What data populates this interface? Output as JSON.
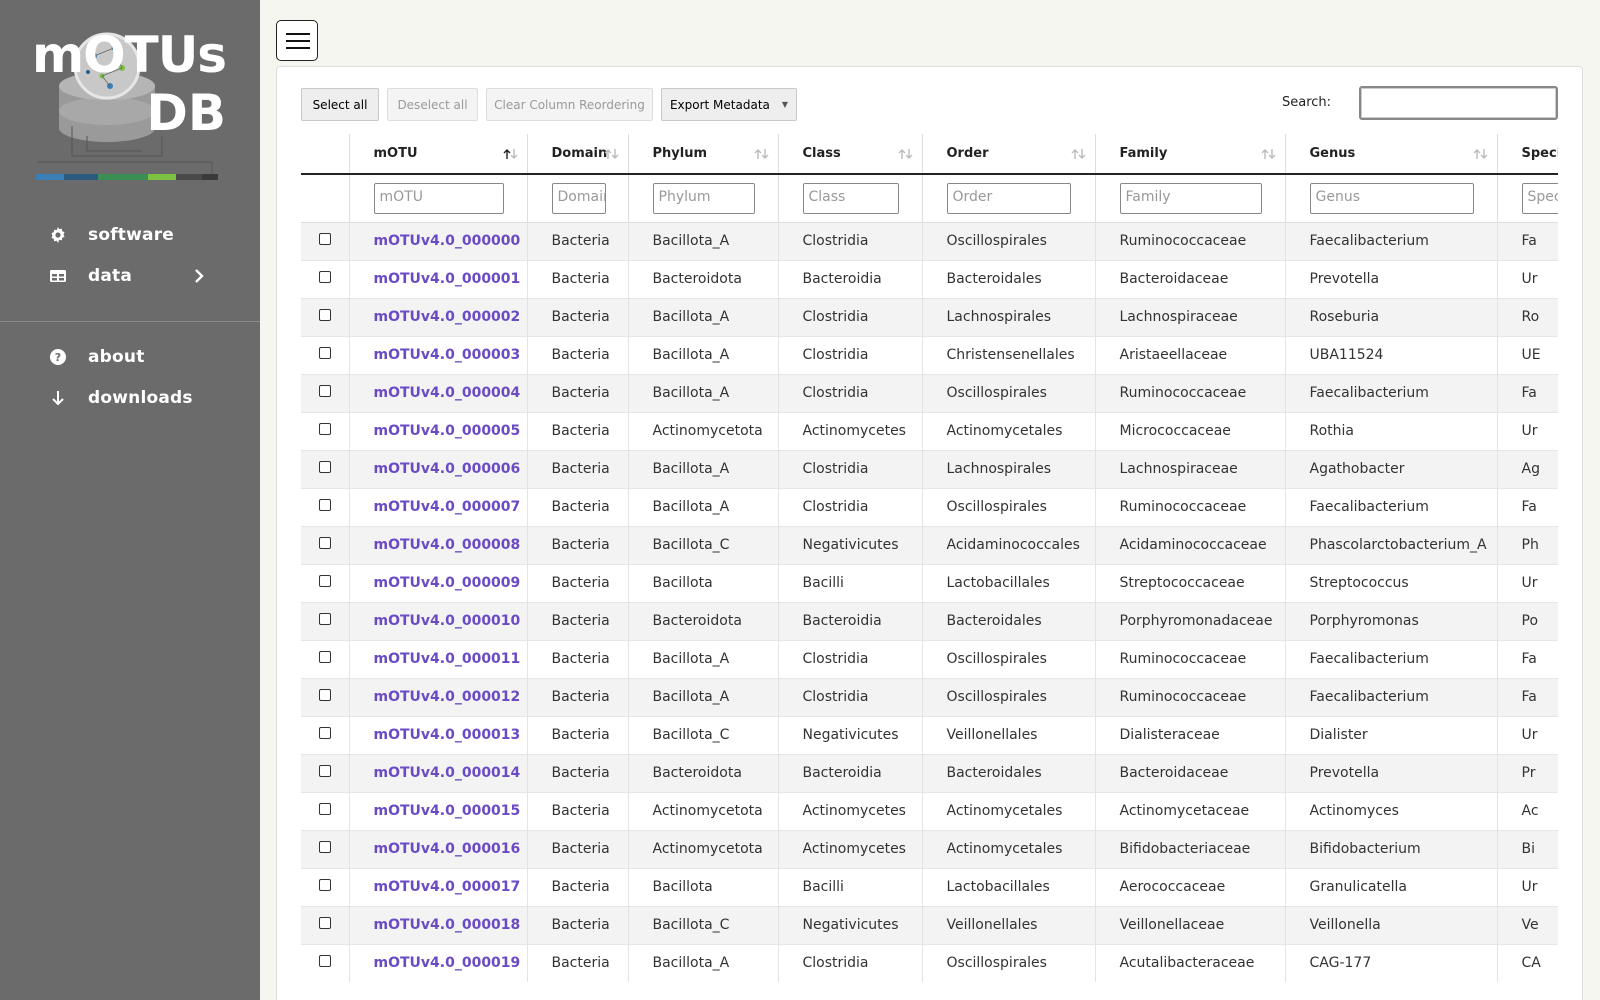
{
  "sidebar": {
    "logo_line1": "mOTUs",
    "logo_line2": "DB",
    "nav": [
      {
        "label": "software",
        "icon": "gear-icon"
      },
      {
        "label": "data",
        "icon": "table-icon"
      },
      {
        "label": "about",
        "icon": "help-circle-icon"
      },
      {
        "label": "downloads",
        "icon": "arrow-down-icon"
      }
    ]
  },
  "toolbar": {
    "select_all": "Select all",
    "deselect_all": "Deselect all",
    "clear_reorder": "Clear Column Reordering",
    "export": "Export Metadata",
    "search_label": "Search:"
  },
  "table": {
    "columns": [
      "mOTU",
      "Domain",
      "Phylum",
      "Class",
      "Order",
      "Family",
      "Genus",
      "Species"
    ],
    "filters": [
      "mOTU",
      "Domain",
      "Phylum",
      "Class",
      "Order",
      "Family",
      "Genus",
      "Species"
    ],
    "rows": [
      [
        "mOTUv4.0_000000",
        "Bacteria",
        "Bacillota_A",
        "Clostridia",
        "Oscillospirales",
        "Ruminococcaceae",
        "Faecalibacterium",
        "Fa"
      ],
      [
        "mOTUv4.0_000001",
        "Bacteria",
        "Bacteroidota",
        "Bacteroidia",
        "Bacteroidales",
        "Bacteroidaceae",
        "Prevotella",
        "Ur"
      ],
      [
        "mOTUv4.0_000002",
        "Bacteria",
        "Bacillota_A",
        "Clostridia",
        "Lachnospirales",
        "Lachnospiraceae",
        "Roseburia",
        "Ro"
      ],
      [
        "mOTUv4.0_000003",
        "Bacteria",
        "Bacillota_A",
        "Clostridia",
        "Christensenellales",
        "Aristaeellaceae",
        "UBA11524",
        "UE"
      ],
      [
        "mOTUv4.0_000004",
        "Bacteria",
        "Bacillota_A",
        "Clostridia",
        "Oscillospirales",
        "Ruminococcaceae",
        "Faecalibacterium",
        "Fa"
      ],
      [
        "mOTUv4.0_000005",
        "Bacteria",
        "Actinomycetota",
        "Actinomycetes",
        "Actinomycetales",
        "Micrococcaceae",
        "Rothia",
        "Ur"
      ],
      [
        "mOTUv4.0_000006",
        "Bacteria",
        "Bacillota_A",
        "Clostridia",
        "Lachnospirales",
        "Lachnospiraceae",
        "Agathobacter",
        "Ag"
      ],
      [
        "mOTUv4.0_000007",
        "Bacteria",
        "Bacillota_A",
        "Clostridia",
        "Oscillospirales",
        "Ruminococcaceae",
        "Faecalibacterium",
        "Fa"
      ],
      [
        "mOTUv4.0_000008",
        "Bacteria",
        "Bacillota_C",
        "Negativicutes",
        "Acidaminococcales",
        "Acidaminococcaceae",
        "Phascolarctobacterium_A",
        "Ph"
      ],
      [
        "mOTUv4.0_000009",
        "Bacteria",
        "Bacillota",
        "Bacilli",
        "Lactobacillales",
        "Streptococcaceae",
        "Streptococcus",
        "Ur"
      ],
      [
        "mOTUv4.0_000010",
        "Bacteria",
        "Bacteroidota",
        "Bacteroidia",
        "Bacteroidales",
        "Porphyromonadaceae",
        "Porphyromonas",
        "Po"
      ],
      [
        "mOTUv4.0_000011",
        "Bacteria",
        "Bacillota_A",
        "Clostridia",
        "Oscillospirales",
        "Ruminococcaceae",
        "Faecalibacterium",
        "Fa"
      ],
      [
        "mOTUv4.0_000012",
        "Bacteria",
        "Bacillota_A",
        "Clostridia",
        "Oscillospirales",
        "Ruminococcaceae",
        "Faecalibacterium",
        "Fa"
      ],
      [
        "mOTUv4.0_000013",
        "Bacteria",
        "Bacillota_C",
        "Negativicutes",
        "Veillonellales",
        "Dialisteraceae",
        "Dialister",
        "Ur"
      ],
      [
        "mOTUv4.0_000014",
        "Bacteria",
        "Bacteroidota",
        "Bacteroidia",
        "Bacteroidales",
        "Bacteroidaceae",
        "Prevotella",
        "Pr"
      ],
      [
        "mOTUv4.0_000015",
        "Bacteria",
        "Actinomycetota",
        "Actinomycetes",
        "Actinomycetales",
        "Actinomycetaceae",
        "Actinomyces",
        "Ac"
      ],
      [
        "mOTUv4.0_000016",
        "Bacteria",
        "Actinomycetota",
        "Actinomycetes",
        "Actinomycetales",
        "Bifidobacteriaceae",
        "Bifidobacterium",
        "Bi"
      ],
      [
        "mOTUv4.0_000017",
        "Bacteria",
        "Bacillota",
        "Bacilli",
        "Lactobacillales",
        "Aerococcaceae",
        "Granulicatella",
        "Ur"
      ],
      [
        "mOTUv4.0_000018",
        "Bacteria",
        "Bacillota_C",
        "Negativicutes",
        "Veillonellales",
        "Veillonellaceae",
        "Veillonella",
        "Ve"
      ],
      [
        "mOTUv4.0_000019",
        "Bacteria",
        "Bacillota_A",
        "Clostridia",
        "Oscillospirales",
        "Acutalibacteraceae",
        "CAG-177",
        "CA"
      ]
    ]
  },
  "colors": {
    "sidebar_bg": "#6b6b6b",
    "link": "#6a4bc4"
  }
}
